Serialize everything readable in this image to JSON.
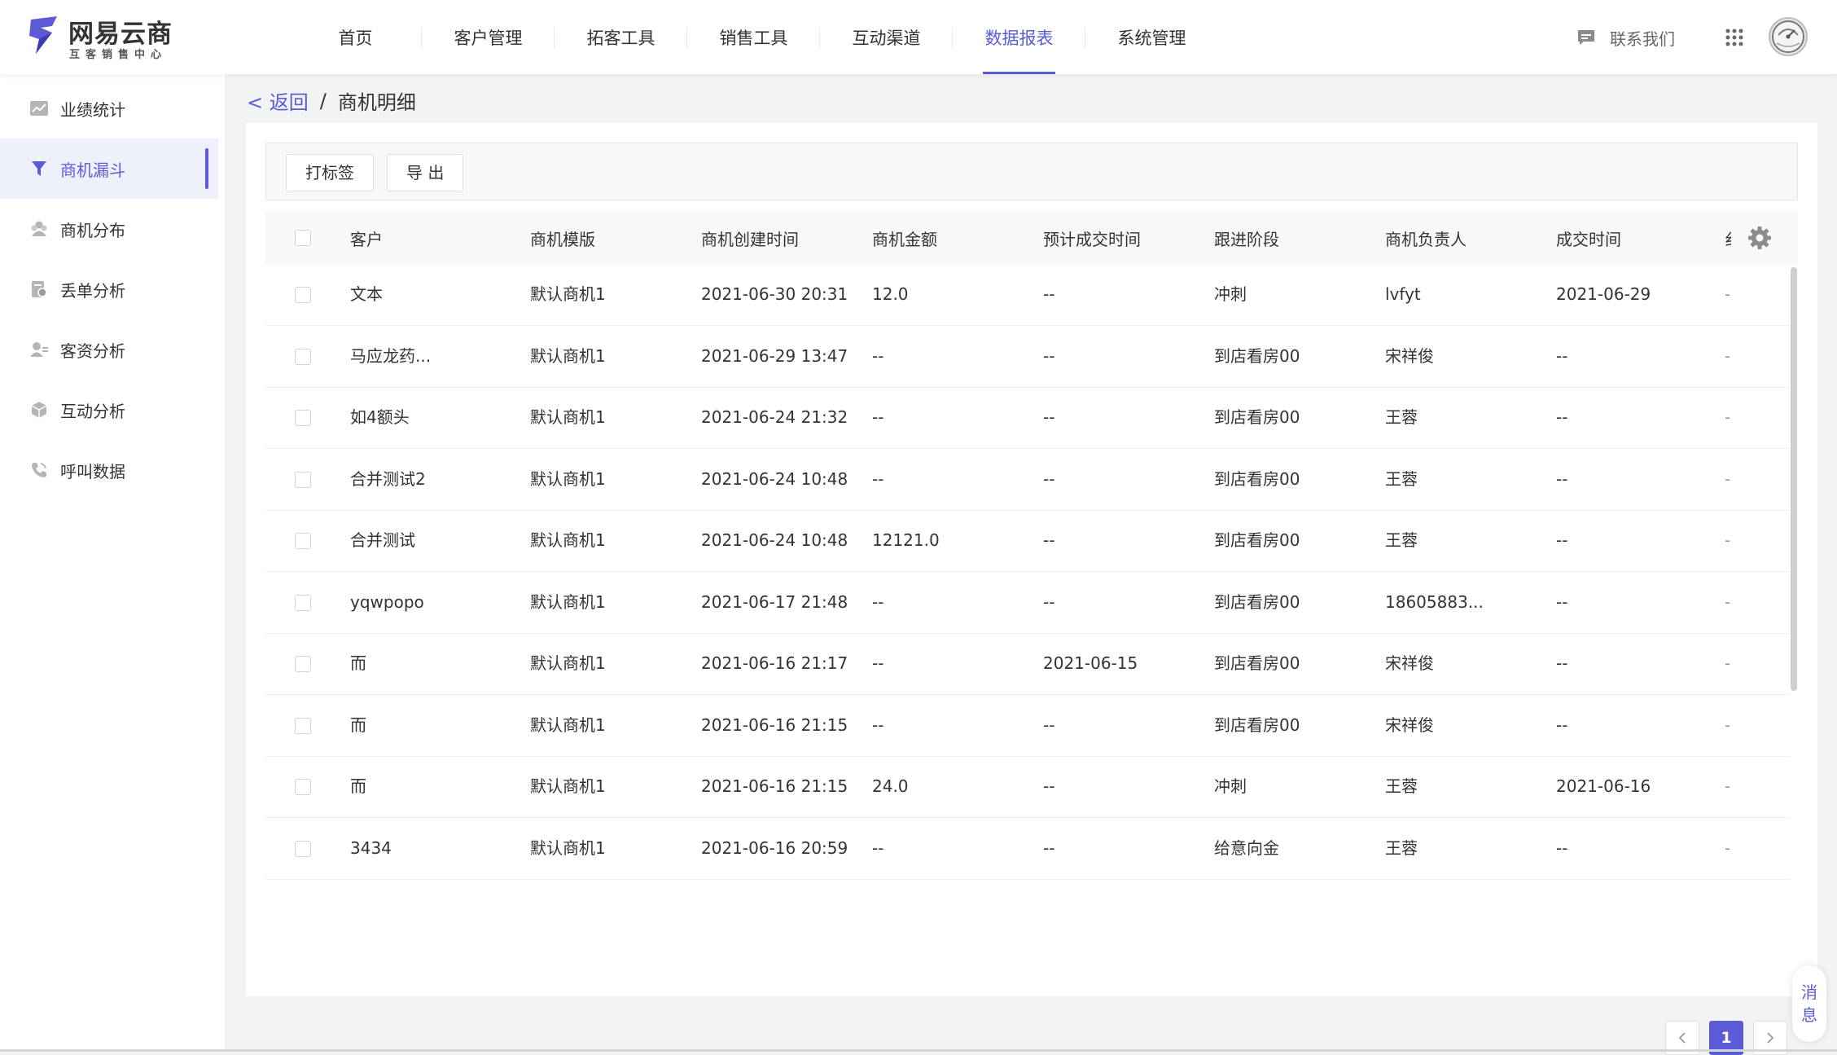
{
  "brand": {
    "title": "网易云商",
    "subtitle": "互客销售中心",
    "accent": "#5b5bd6"
  },
  "nav": [
    "首页",
    "客户管理",
    "拓客工具",
    "销售工具",
    "互动渠道",
    "数据报表",
    "系统管理"
  ],
  "nav_active": "数据报表",
  "header": {
    "contact": "联系我们"
  },
  "sidebar": {
    "items": [
      {
        "label": "业绩统计",
        "icon": "chart-icon"
      },
      {
        "label": "商机漏斗",
        "icon": "funnel-icon"
      },
      {
        "label": "商机分布",
        "icon": "people-icon"
      },
      {
        "label": "丢单分析",
        "icon": "doc-icon"
      },
      {
        "label": "客资分析",
        "icon": "user-icon"
      },
      {
        "label": "互动分析",
        "icon": "cube-icon"
      },
      {
        "label": "呼叫数据",
        "icon": "phone-icon"
      }
    ],
    "active": "商机漏斗"
  },
  "breadcrumb": {
    "back": "< 返回",
    "sep": "/",
    "current": "商机明细"
  },
  "toolbar": {
    "tag_label": "打标签",
    "export_label": "导 出"
  },
  "table": {
    "columns": [
      "客户",
      "商机模版",
      "商机创建时间",
      "商机金额",
      "预计成交时间",
      "跟进阶段",
      "商机负责人",
      "成交时间",
      "纟"
    ],
    "rows": [
      [
        "文本",
        "默认商机1",
        "2021-06-30 20:31",
        "12.0",
        "--",
        "冲刺",
        "lvfyt",
        "2021-06-29",
        "-"
      ],
      [
        "马应龙药...",
        "默认商机1",
        "2021-06-29 13:47",
        "--",
        "--",
        "到店看房00",
        "宋祥俊",
        "--",
        "-"
      ],
      [
        "如4额头",
        "默认商机1",
        "2021-06-24 21:32",
        "--",
        "--",
        "到店看房00",
        "王蓉",
        "--",
        "-"
      ],
      [
        "合并测试2",
        "默认商机1",
        "2021-06-24 10:48",
        "--",
        "--",
        "到店看房00",
        "王蓉",
        "--",
        "-"
      ],
      [
        "合并测试",
        "默认商机1",
        "2021-06-24 10:48",
        "12121.0",
        "--",
        "到店看房00",
        "王蓉",
        "--",
        "-"
      ],
      [
        "yqwpopo",
        "默认商机1",
        "2021-06-17 21:48",
        "--",
        "--",
        "到店看房00",
        "18605883...",
        "--",
        "-"
      ],
      [
        "而",
        "默认商机1",
        "2021-06-16 21:17",
        "--",
        "2021-06-15",
        "到店看房00",
        "宋祥俊",
        "--",
        "-"
      ],
      [
        "而",
        "默认商机1",
        "2021-06-16 21:15",
        "--",
        "--",
        "到店看房00",
        "宋祥俊",
        "--",
        "-"
      ],
      [
        "而",
        "默认商机1",
        "2021-06-16 21:15",
        "24.0",
        "--",
        "冲刺",
        "王蓉",
        "2021-06-16",
        "-"
      ],
      [
        "3434",
        "默认商机1",
        "2021-06-16 20:59",
        "--",
        "--",
        "给意向金",
        "王蓉",
        "--",
        "-"
      ]
    ]
  },
  "pagination": {
    "current": "1"
  },
  "message": {
    "line1": "消",
    "line2": "息"
  }
}
